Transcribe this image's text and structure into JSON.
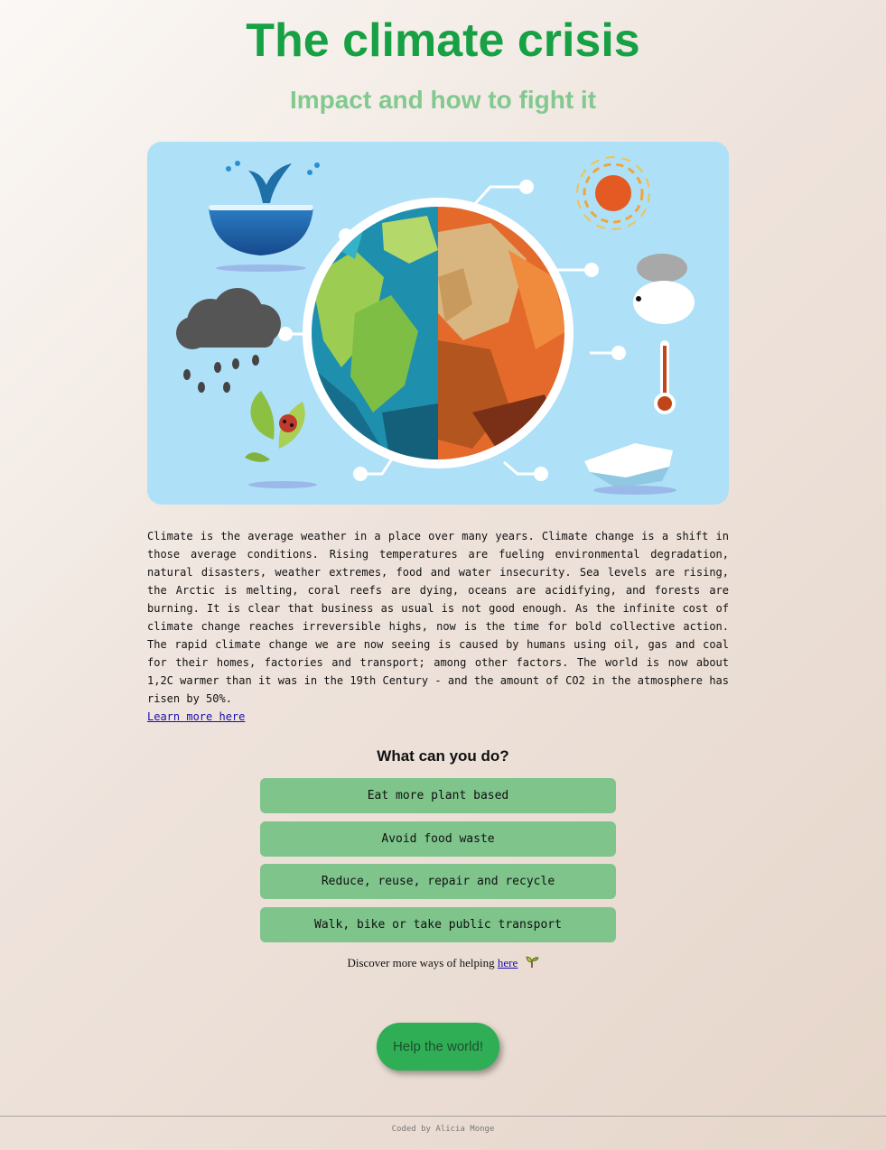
{
  "header": {
    "title": "The climate crisis",
    "subtitle": "Impact and how to fight it"
  },
  "hero": {
    "icon": "earth-climate-illustration"
  },
  "intro": {
    "paragraph": "Climate is the average weather in a place over many years. Climate change is a shift in those average conditions. Rising temperatures are fueling environmental degradation, natural disasters, weather extremes, food and water insecurity. Sea levels are rising, the Arctic is melting, coral reefs are dying, oceans are acidifying, and forests are burning. It is clear that business as usual is not good enough. As the infinite cost of climate change reaches irreversible highs, now is the time for bold collective action. The rapid climate change we are now seeing is caused by humans using oil, gas and coal for their homes, factories and transport; among other factors. The world is now about 1,2C warmer than it was in the 19th Century - and the amount of CO2 in the atmosphere has risen by 50%.",
    "learn_more": "Learn more here"
  },
  "actions": {
    "heading": "What can you do?",
    "items": [
      "Eat more plant based",
      "Avoid food waste",
      "Reduce, reuse, repair and recycle",
      "Walk, bike or take public transport"
    ]
  },
  "discover": {
    "text": "Discover more ways of helping",
    "link": "here",
    "icon": "sprout-icon"
  },
  "cta": {
    "label": "Help the world!"
  },
  "footer": {
    "credit": "Coded by Alicia Monge"
  },
  "colors": {
    "title": "#17a044",
    "subtitle": "#82c98f",
    "action_button": "#7ec48b",
    "cta_button": "#2fae55",
    "link": "#1a0dab"
  }
}
